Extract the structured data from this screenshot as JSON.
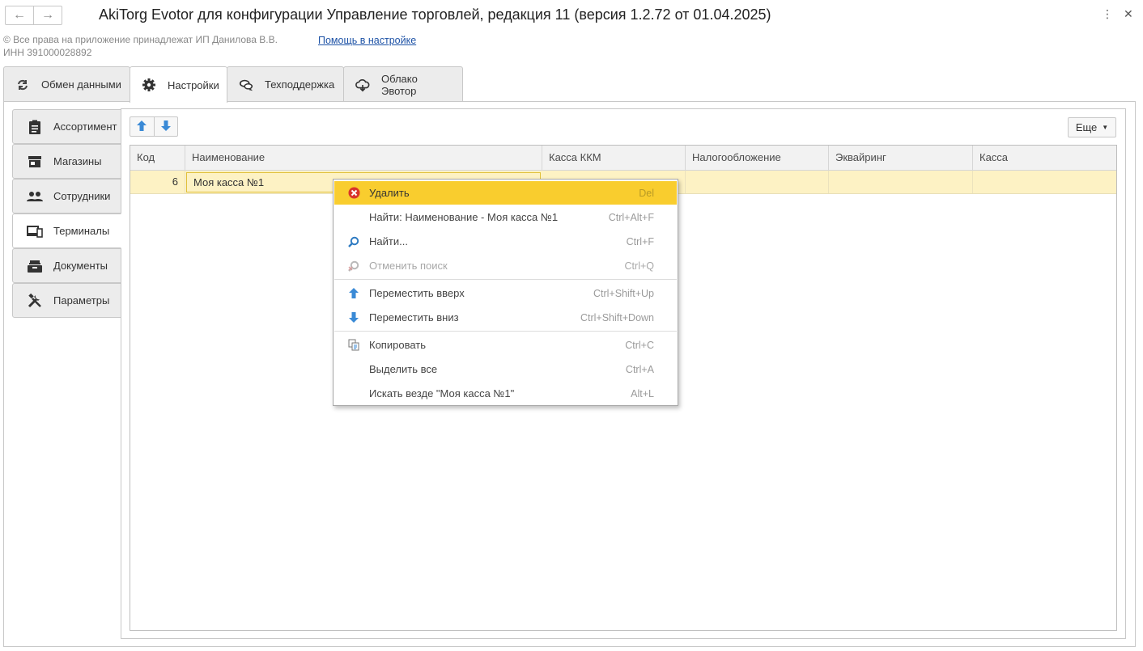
{
  "window": {
    "title": "AkiTorg Evotor для конфигурации Управление торговлей, редакция 11 (версия 1.2.72 от 01.04.2025)",
    "nav_back_icon": "arrow-left-icon",
    "nav_forward_icon": "arrow-right-icon",
    "more_icon": "vertical-dots-icon",
    "close_icon": "close-icon"
  },
  "header": {
    "copyright": "© Все права на приложение принадлежат ИП Данилова В.В.",
    "inn": "ИНН 391000028892",
    "help_link": "Помощь в настройке"
  },
  "top_tabs": [
    {
      "label": "Обмен данными",
      "icon": "sync-icon"
    },
    {
      "label": "Настройки",
      "icon": "gear-icon",
      "active": true
    },
    {
      "label": "Техподдержка",
      "icon": "chat-bubbles-icon"
    },
    {
      "label": "Облако Эвотор",
      "icon": "cloud-icon"
    }
  ],
  "side_tabs": [
    {
      "label": "Ассортимент",
      "icon": "clipboard-icon"
    },
    {
      "label": "Магазины",
      "icon": "store-icon"
    },
    {
      "label": "Сотрудники",
      "icon": "people-icon"
    },
    {
      "label": "Терминалы",
      "icon": "devices-icon",
      "active": true
    },
    {
      "label": "Документы",
      "icon": "tray-icon"
    },
    {
      "label": "Параметры",
      "icon": "tools-icon"
    }
  ],
  "toolbar": {
    "move_up_icon": "arrow-up-icon",
    "move_down_icon": "arrow-down-icon",
    "more_label": "Еще"
  },
  "table": {
    "columns": [
      "Код",
      "Наименование",
      "Касса ККМ",
      "Налогообложение",
      "Эквайринг",
      "Касса"
    ],
    "rows": [
      {
        "code": "6",
        "name": "Моя касса №1",
        "kkm": "",
        "tax": "",
        "acquiring": "",
        "cash": ""
      }
    ]
  },
  "context_menu": {
    "items": [
      {
        "label": "Удалить",
        "shortcut": "Del",
        "icon": "delete-icon",
        "highlighted": true
      },
      {
        "label": "Найти: Наименование - Моя касса №1",
        "shortcut": "Ctrl+Alt+F",
        "icon": ""
      },
      {
        "label": "Найти...",
        "shortcut": "Ctrl+F",
        "icon": "search-icon"
      },
      {
        "label": "Отменить поиск",
        "shortcut": "Ctrl+Q",
        "icon": "cancel-search-icon",
        "disabled": true
      },
      {
        "label": "Переместить вверх",
        "shortcut": "Ctrl+Shift+Up",
        "icon": "arrow-up-icon"
      },
      {
        "label": "Переместить вниз",
        "shortcut": "Ctrl+Shift+Down",
        "icon": "arrow-down-icon"
      },
      {
        "label": "Копировать",
        "shortcut": "Ctrl+C",
        "icon": "copy-icon"
      },
      {
        "label": "Выделить все",
        "shortcut": "Ctrl+A",
        "icon": ""
      },
      {
        "label": "Искать везде \"Моя касса №1\"",
        "shortcut": "Alt+L",
        "icon": ""
      }
    ]
  },
  "colors": {
    "accent_highlight": "#f9cd2e",
    "selected_row": "#fdf2c4",
    "link": "#1d52a6",
    "arrow_blue": "#3a8ad6",
    "delete_red": "#d9342b"
  }
}
